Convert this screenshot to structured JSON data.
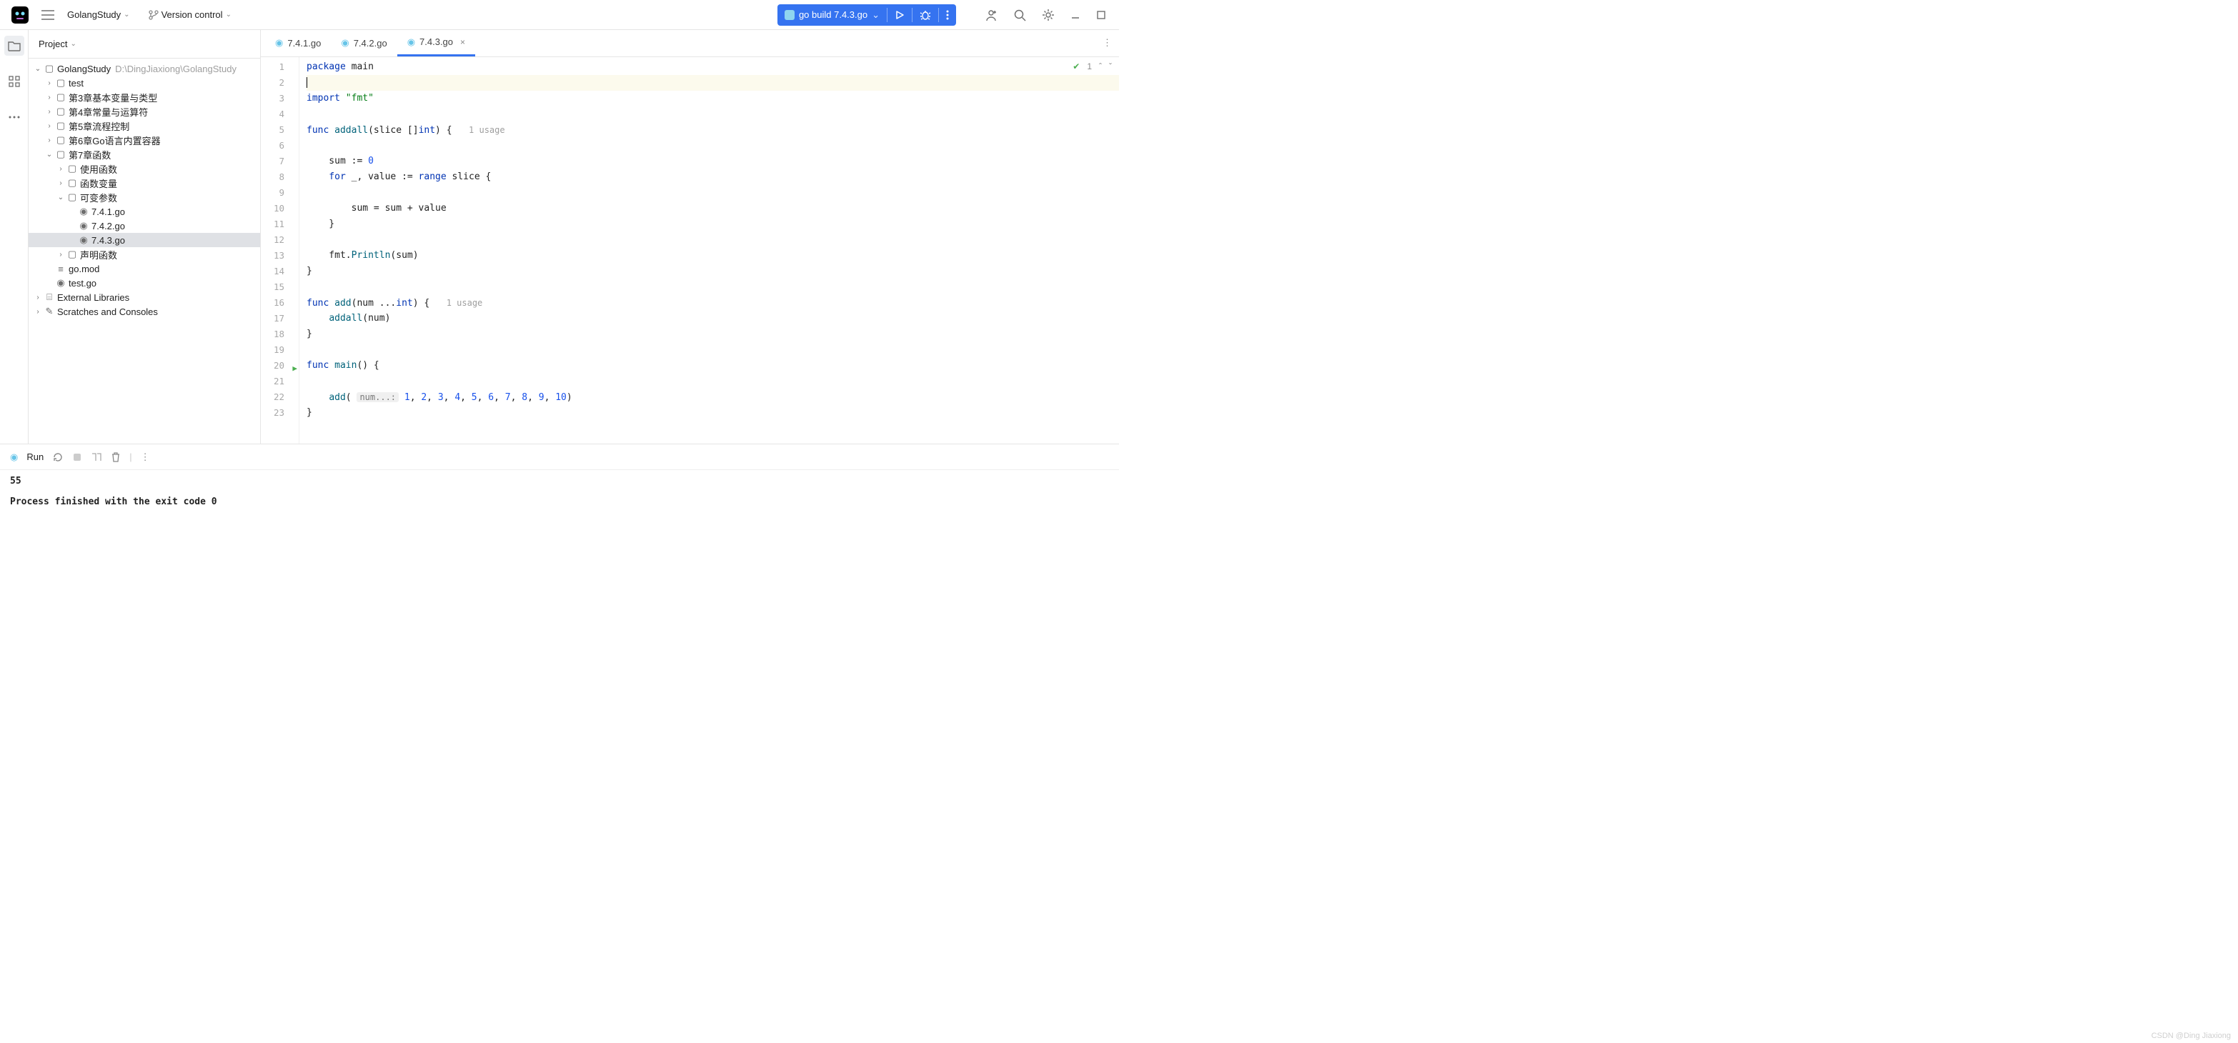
{
  "topbar": {
    "project_name": "GolangStudy",
    "vcs_label": "Version control",
    "run_config": "go build 7.4.3.go"
  },
  "sidebar": {
    "title": "Project",
    "root": {
      "name": "GolangStudy",
      "path": "D:\\DingJiaxiong\\GolangStudy"
    },
    "nodes": [
      "test",
      "第3章基本变量与类型",
      "第4章常量与运算符",
      "第5章流程控制",
      "第6章Go语言内置容器",
      "第7章函数",
      "使用函数",
      "函数变量",
      "可变参数",
      "7.4.1.go",
      "7.4.2.go",
      "7.4.3.go",
      "声明函数",
      "go.mod",
      "test.go"
    ],
    "external": "External Libraries",
    "scratches": "Scratches and Consoles"
  },
  "tabs": [
    "7.4.1.go",
    "7.4.2.go",
    "7.4.3.go"
  ],
  "inspection": {
    "count": "1"
  },
  "code": {
    "l1_kw": "package",
    "l1_pkg": "main",
    "l3_kw": "import",
    "l3_str": "\"fmt\"",
    "l5_func": "func",
    "l5_name": "addall",
    "l5_sig": "(slice []",
    "l5_int": "int",
    "l5_rest": ") {",
    "l5_hint": "1 usage",
    "l7": "    sum := ",
    "l7_num": "0",
    "l8_for": "    for",
    "l8_mid": " _, value := ",
    "l8_range": "range",
    "l8_rest": " slice {",
    "l10": "        sum = sum + value",
    "l11": "    }",
    "l13_a": "    fmt.",
    "l13_fn": "Println",
    "l13_b": "(sum)",
    "l14": "}",
    "l16_func": "func",
    "l16_name": "add",
    "l16_a": "(num ...",
    "l16_int": "int",
    "l16_b": ") {",
    "l16_hint": "1 usage",
    "l17_a": "    ",
    "l17_fn": "addall",
    "l17_b": "(num)",
    "l18": "}",
    "l20_func": "func",
    "l20_name": "main",
    "l20_rest": "() {",
    "l22_a": "    ",
    "l22_fn": "add",
    "l22_b": "( ",
    "l22_hint": "num...:",
    "l22_nums": [
      " 1",
      ", ",
      "2",
      ", ",
      "3",
      ", ",
      "4",
      ", ",
      "5",
      ", ",
      "6",
      ", ",
      "7",
      ", ",
      "8",
      ", ",
      "9",
      ", ",
      "10"
    ],
    "l22_c": ")",
    "l23": "}"
  },
  "run": {
    "title": "Run"
  },
  "console": {
    "out": "55",
    "exit": "Process finished with the exit code 0"
  },
  "watermark": "CSDN @Ding Jiaxiong"
}
